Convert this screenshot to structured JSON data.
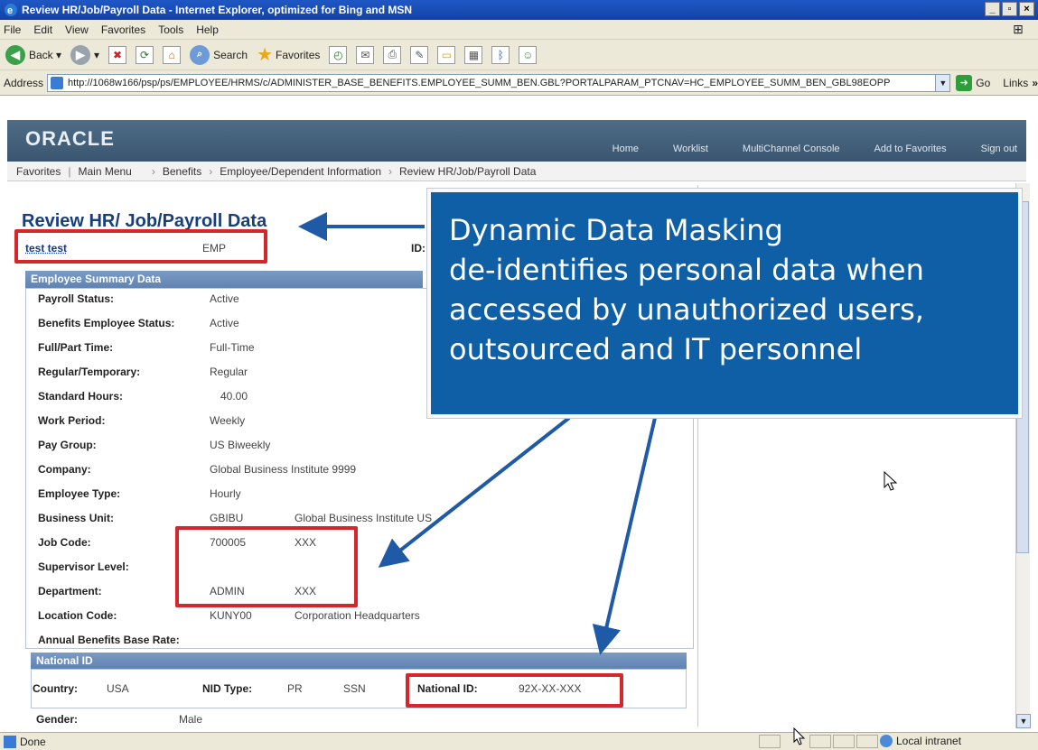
{
  "window": {
    "title": "Review HR/Job/Payroll Data - Internet Explorer, optimized for Bing and MSN",
    "controls": [
      "_",
      "▫",
      "×"
    ]
  },
  "menu": [
    "File",
    "Edit",
    "View",
    "Favorites",
    "Tools",
    "Help"
  ],
  "toolbar": {
    "back": "Back",
    "search": "Search",
    "favorites": "Favorites"
  },
  "address": {
    "label": "Address",
    "url": "http://1068w166/psp/ps/EMPLOYEE/HRMS/c/ADMINISTER_BASE_BENEFITS.EMPLOYEE_SUMM_BEN.GBL?PORTALPARAM_PTCNAV=HC_EMPLOYEE_SUMM_BEN_GBL98EOPP",
    "go": "Go",
    "links": "Links"
  },
  "oracle": {
    "logo": "ORACLE",
    "nav": [
      "Home",
      "Worklist",
      "MultiChannel Console",
      "Add to Favorites",
      "Sign out"
    ]
  },
  "breadcrumbs": {
    "favorites": "Favorites",
    "main_menu": "Main Menu",
    "items": [
      "Benefits",
      "Employee/Dependent Information",
      "Review HR/Job/Payroll Data"
    ]
  },
  "page": {
    "title": "Review HR/ Job/Payroll Data",
    "employee_name": "test test",
    "employee_type": "EMP",
    "id_label": "ID:"
  },
  "summary": {
    "header": "Employee Summary Data",
    "fields": [
      {
        "label": "Payroll Status:",
        "value": "Active"
      },
      {
        "label": "Benefits Employee Status:",
        "value": "Active"
      },
      {
        "label": "Full/Part Time:",
        "value": "Full-Time"
      },
      {
        "label": "Regular/Temporary:",
        "value": "Regular"
      },
      {
        "label": "Standard Hours:",
        "value": "40.00"
      },
      {
        "label": "Work Period:",
        "value": "Weekly"
      },
      {
        "label": "Pay Group:",
        "value": "US Biweekly"
      },
      {
        "label": "Company:",
        "value": "Global Business Institute 9999"
      },
      {
        "label": "Employee Type:",
        "value": "Hourly"
      },
      {
        "label": "Business Unit:",
        "value": "GBIBU",
        "extra": "Global Business Institute US"
      },
      {
        "label": "Job Code:",
        "value": "700005",
        "extra": "XXX"
      },
      {
        "label": "Supervisor Level:",
        "value": ""
      },
      {
        "label": "Department:",
        "value": "ADMIN",
        "extra": "XXX"
      },
      {
        "label": "Location Code:",
        "value": "KUNY00",
        "extra": "Corporation Headquarters"
      },
      {
        "label": "Annual Benefits Base Rate:",
        "value": ""
      }
    ]
  },
  "national_id": {
    "header": "National ID",
    "country_label": "Country:",
    "country_value": "USA",
    "nid_type_label": "NID Type:",
    "nid_type_value": "PR",
    "nid_type_code": "SSN",
    "nid_label": "National ID:",
    "nid_value": "92X-XX-XXX"
  },
  "gender": {
    "label": "Gender:",
    "value": "Male"
  },
  "callout": {
    "lines": [
      "Dynamic Data Masking",
      "de-identifies personal data when",
      "accessed by unauthorized users,",
      "outsourced and IT personnel"
    ],
    "background": "#0f5fa6"
  },
  "status": {
    "left": "Done",
    "zone": "Local intranet"
  },
  "colors": {
    "highlight": "#d4262b",
    "arrow": "#1f5aa6",
    "oracle_bar": "#4f6d87"
  }
}
